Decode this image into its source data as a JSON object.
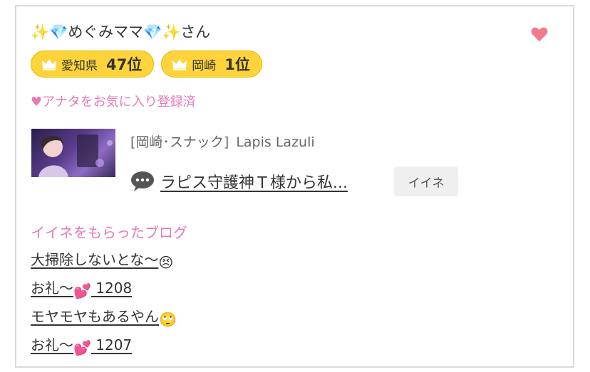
{
  "user": {
    "name_deco_left": "✨",
    "gem": "💎",
    "name": "めぐみママ",
    "name_deco_right": "✨",
    "honorific": "さん"
  },
  "rankings": [
    {
      "area": "愛知県",
      "rank": "47位"
    },
    {
      "area": "岡崎",
      "rank": "1位"
    }
  ],
  "favorite_status": "♥アナタをお気に入り登録済",
  "shop": {
    "category": "[岡崎･スナック]",
    "name": "Lapis Lazuli"
  },
  "post": {
    "title": "ラピス守護神Ｔ様から私..."
  },
  "like_button_label": "イイネ",
  "blogs": {
    "title": "イイネをもらったブログ",
    "items": [
      {
        "text": "大掃除しないとな〜",
        "emoji": "😣"
      },
      {
        "text": "お礼〜",
        "emoji": "💕",
        "suffix": " 1208"
      },
      {
        "text": "モヤモヤもあるやん",
        "emoji": "🙄"
      },
      {
        "text": "お礼〜",
        "emoji": "💕",
        "suffix": " 1207"
      }
    ]
  },
  "colors": {
    "accent_pink": "#e67ab8",
    "badge_gold": "#ffd43b",
    "heart": "#f07b8c"
  }
}
